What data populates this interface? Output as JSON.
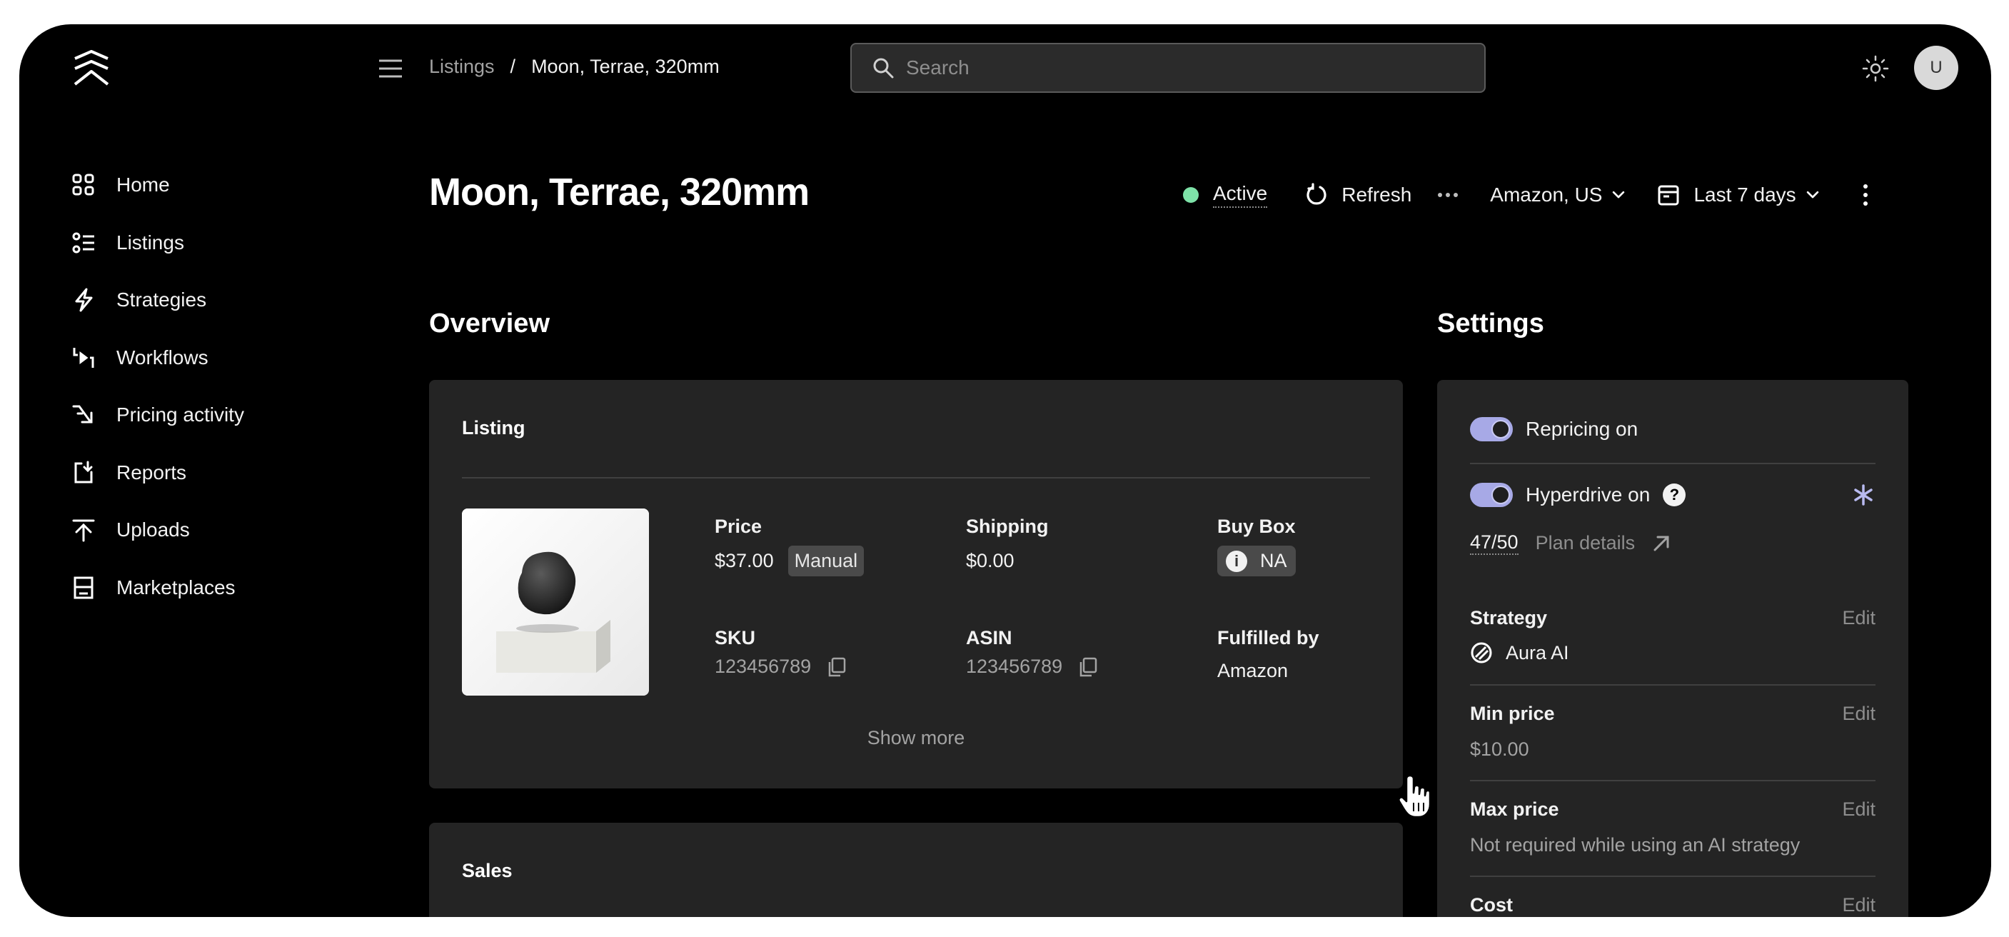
{
  "sidebar": {
    "items": [
      {
        "label": "Home",
        "icon": "grid-icon"
      },
      {
        "label": "Listings",
        "icon": "list-icon"
      },
      {
        "label": "Strategies",
        "icon": "bolt-icon"
      },
      {
        "label": "Workflows",
        "icon": "workflow-icon"
      },
      {
        "label": "Pricing activity",
        "icon": "arrow-down-right-icon"
      },
      {
        "label": "Reports",
        "icon": "report-icon"
      },
      {
        "label": "Uploads",
        "icon": "upload-icon"
      },
      {
        "label": "Marketplaces",
        "icon": "store-icon"
      }
    ]
  },
  "topbar": {
    "breadcrumb_root": "Listings",
    "breadcrumb_sep": "/",
    "breadcrumb_current": "Moon, Terrae, 320mm",
    "search_placeholder": "Search",
    "avatar_initial": "U"
  },
  "header": {
    "title": "Moon, Terrae, 320mm",
    "status": "Active",
    "refresh_label": "Refresh",
    "marketplace": "Amazon, US",
    "date_range": "Last 7 days"
  },
  "overview": {
    "title": "Overview",
    "listing_card": {
      "title": "Listing",
      "price_label": "Price",
      "price_value": "$37.00",
      "price_tag": "Manual",
      "shipping_label": "Shipping",
      "shipping_value": "$0.00",
      "buybox_label": "Buy Box",
      "buybox_value": "NA",
      "sku_label": "SKU",
      "sku_value": "123456789",
      "asin_label": "ASIN",
      "asin_value": "123456789",
      "fulfilled_label": "Fulfilled by",
      "fulfilled_value": "Amazon",
      "show_more": "Show more"
    },
    "sales_card": {
      "title": "Sales"
    }
  },
  "settings": {
    "title": "Settings",
    "repricing_label": "Repricing on",
    "hyperdrive_label": "Hyperdrive on",
    "hyperdrive_usage": "47/50",
    "plan_details": "Plan details",
    "edit_label": "Edit",
    "strategy_label": "Strategy",
    "strategy_value": "Aura AI",
    "min_price_label": "Min price",
    "min_price_value": "$10.00",
    "max_price_label": "Max price",
    "max_price_value": "Not required while using an AI strategy",
    "cost_label": "Cost"
  },
  "colors": {
    "background": "#000000",
    "card": "#242424",
    "status_active": "#7ee2a8",
    "toggle_on": "#a7a9e6"
  }
}
